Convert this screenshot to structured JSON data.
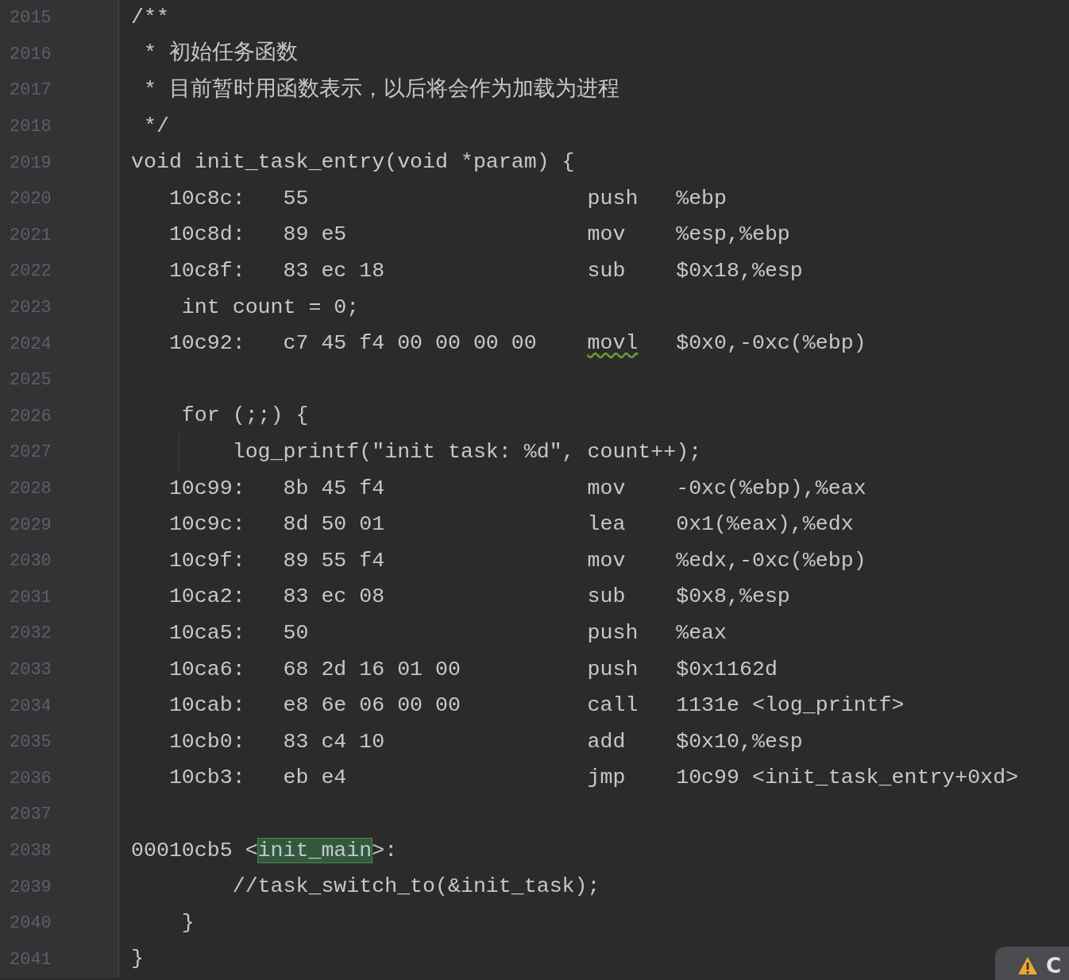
{
  "editor": {
    "lines": [
      {
        "number": "2015",
        "kind": "code",
        "text": "/**"
      },
      {
        "number": "2016",
        "kind": "code",
        "text": " * 初始任务函数"
      },
      {
        "number": "2017",
        "kind": "code",
        "text": " * 目前暂时用函数表示，以后将会作为加载为进程"
      },
      {
        "number": "2018",
        "kind": "code",
        "text": " */"
      },
      {
        "number": "2019",
        "kind": "code",
        "text": "void init_task_entry(void *param) {"
      },
      {
        "number": "2020",
        "kind": "asm",
        "address": "10c8c:",
        "bytes": "55",
        "mnemonic": "push",
        "operands": "%ebp",
        "warning": false
      },
      {
        "number": "2021",
        "kind": "asm",
        "address": "10c8d:",
        "bytes": "89 e5",
        "mnemonic": "mov",
        "operands": "%esp,%ebp",
        "warning": false
      },
      {
        "number": "2022",
        "kind": "asm",
        "address": "10c8f:",
        "bytes": "83 ec 18",
        "mnemonic": "sub",
        "operands": "$0x18,%esp",
        "warning": false
      },
      {
        "number": "2023",
        "kind": "code",
        "text": "    int count = 0;"
      },
      {
        "number": "2024",
        "kind": "asm",
        "address": "10c92:",
        "bytes": "c7 45 f4 00 00 00 00",
        "mnemonic": "movl",
        "operands": "$0x0,-0xc(%ebp)",
        "warning": true
      },
      {
        "number": "2025",
        "kind": "blank"
      },
      {
        "number": "2026",
        "kind": "code",
        "text": "    for (;;) {"
      },
      {
        "number": "2027",
        "kind": "code",
        "text": "        log_printf(\"init task: %d\", count++);",
        "guide": true
      },
      {
        "number": "2028",
        "kind": "asm",
        "address": "10c99:",
        "bytes": "8b 45 f4",
        "mnemonic": "mov",
        "operands": "-0xc(%ebp),%eax",
        "warning": false
      },
      {
        "number": "2029",
        "kind": "asm",
        "address": "10c9c:",
        "bytes": "8d 50 01",
        "mnemonic": "lea",
        "operands": "0x1(%eax),%edx",
        "warning": false
      },
      {
        "number": "2030",
        "kind": "asm",
        "address": "10c9f:",
        "bytes": "89 55 f4",
        "mnemonic": "mov",
        "operands": "%edx,-0xc(%ebp)",
        "warning": false
      },
      {
        "number": "2031",
        "kind": "asm",
        "address": "10ca2:",
        "bytes": "83 ec 08",
        "mnemonic": "sub",
        "operands": "$0x8,%esp",
        "warning": false
      },
      {
        "number": "2032",
        "kind": "asm",
        "address": "10ca5:",
        "bytes": "50",
        "mnemonic": "push",
        "operands": "%eax",
        "warning": false
      },
      {
        "number": "2033",
        "kind": "asm",
        "address": "10ca6:",
        "bytes": "68 2d 16 01 00",
        "mnemonic": "push",
        "operands": "$0x1162d",
        "warning": false
      },
      {
        "number": "2034",
        "kind": "asm",
        "address": "10cab:",
        "bytes": "e8 6e 06 00 00",
        "mnemonic": "call",
        "operands": "1131e <log_printf>",
        "warning": false
      },
      {
        "number": "2035",
        "kind": "asm",
        "address": "10cb0:",
        "bytes": "83 c4 10",
        "mnemonic": "add",
        "operands": "$0x10,%esp",
        "warning": false
      },
      {
        "number": "2036",
        "kind": "asm",
        "address": "10cb3:",
        "bytes": "eb e4",
        "mnemonic": "jmp",
        "operands": "10c99 <init_task_entry+0xd>",
        "warning": false
      },
      {
        "number": "2037",
        "kind": "blank"
      },
      {
        "number": "2038",
        "kind": "label",
        "segments": [
          {
            "text": "00010cb5 <",
            "highlighted": false
          },
          {
            "text": "init_main",
            "highlighted": true
          },
          {
            "text": ">:",
            "highlighted": false
          }
        ]
      },
      {
        "number": "2039",
        "kind": "code",
        "text": "        //task_switch_to(&init_task);"
      },
      {
        "number": "2040",
        "kind": "code",
        "text": "    }"
      },
      {
        "number": "2041",
        "kind": "code",
        "text": "}"
      }
    ]
  },
  "status_badge": {
    "text": "C"
  }
}
